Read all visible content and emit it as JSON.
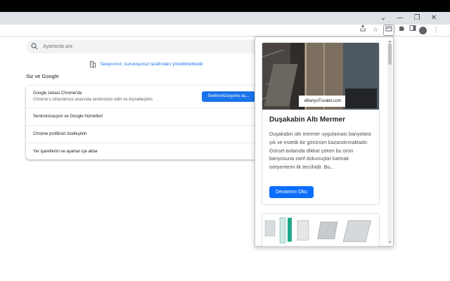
{
  "window": {
    "minimize_glyph": "—",
    "maximize_glyph": "❐",
    "close_glyph": "✕",
    "tab_menu_glyph": "⌄"
  },
  "toolbar": {
    "icons": [
      "share-icon",
      "bookmark-star-icon",
      "extension-active-icon",
      "puzzle-extensions-icon",
      "side-panel-icon",
      "profile-avatar-icon",
      "kebab-menu-icon"
    ]
  },
  "settings": {
    "search_placeholder": "Ayarlarda ara",
    "managed_notice": "Tarayıcınız, kuruluşunuz tarafından yönetilmektedir",
    "section_title": "Siz ve Google",
    "sync_card": {
      "title": "Google zekası Chrome'da",
      "subtitle": "Chrome'u cihazlarınız arasında senkronize edin ve kişiselleştirin",
      "button_label": "Senkronizasyonu aç..."
    },
    "rows": [
      {
        "label": "Senkronizasyon ve Google hizmetleri"
      },
      {
        "label": "Chrome profilinizi özelleştirin"
      },
      {
        "label": "Yer işaretlerini ve ayarları içe aktar"
      }
    ]
  },
  "popup": {
    "article": {
      "image_watermark": "eBanyoTuvalet.com",
      "title": "Duşakabin Altı Mermer",
      "text": "Duşakabin altı mermer uygulaması banyolara şık ve estetik bir görünüm kazandırmaktadır. Görsel anlamda dikkat çeken bu ürün banyosuna zarif dokunuşlar katmak isteyenlerin ilk tercihidir. Bu...",
      "button_label": "Devamını Oku"
    }
  },
  "colors": {
    "accent": "#1a73e8",
    "popup_button": "#0d6efd",
    "titlebar": "#000000"
  }
}
